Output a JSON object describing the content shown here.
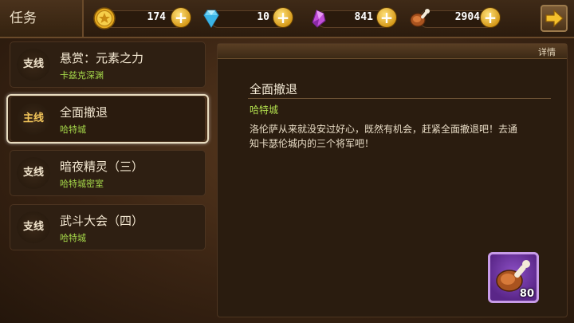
{
  "header": {
    "title": "任务",
    "resources": [
      {
        "icon": "gold-coin-icon",
        "value": "174"
      },
      {
        "icon": "diamond-icon",
        "value": "10"
      },
      {
        "icon": "crystal-icon",
        "value": "841"
      },
      {
        "icon": "meat-drumstick-icon",
        "value": "2904"
      }
    ],
    "plus_label": "+"
  },
  "quests": [
    {
      "tag": "支线",
      "name": "悬赏：元素之力",
      "location": "卡兹克深渊",
      "selected": false
    },
    {
      "tag": "主线",
      "name": "全面撤退",
      "location": "哈特城",
      "selected": true
    },
    {
      "tag": "支线",
      "name": "暗夜精灵（三）",
      "location": "哈特城密室",
      "selected": false
    },
    {
      "tag": "支线",
      "name": "武斗大会（四）",
      "location": "哈特城",
      "selected": false
    }
  ],
  "detail": {
    "header_label": "详情",
    "title": "全面撤退",
    "location": "哈特城",
    "description": "洛伦萨从来就没安过好心，既然有机会，赶紧全面撤退吧！去通知卡瑟伦城内的三个将军吧！",
    "reward": {
      "icon": "meat-drumstick-icon",
      "count": "80"
    }
  },
  "colors": {
    "accent_green": "#a6d94a",
    "main_tag": "#f2c55a",
    "reward_bg": "#5a2688"
  }
}
